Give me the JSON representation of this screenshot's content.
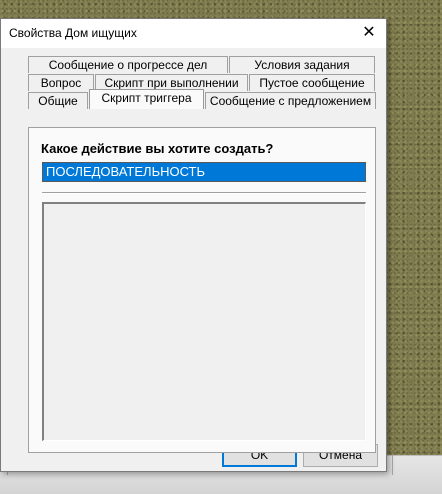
{
  "window": {
    "title": "Свойства Дом ищущих",
    "close_glyph": "✕"
  },
  "tabs": {
    "row1": [
      "Сообщение о прогрессе дел",
      "Условия задания"
    ],
    "row2": [
      "Вопрос",
      "Скрипт при выполнении",
      "Пустое сообщение"
    ],
    "row3": [
      "Общие",
      "Скрипт триггера",
      "Сообщение с предложением"
    ],
    "active": "Скрипт триггера"
  },
  "panel": {
    "question": "Какое действие вы хотите создать?",
    "selected_action": "ПОСЛЕДОВАТЕЛЬНОСТЬ"
  },
  "buttons": {
    "ok": "OK",
    "cancel": "Отмена"
  },
  "colors": {
    "selection": "#0078d7",
    "dialog_bg": "#f0f0f0",
    "desktop": "#7d7a4e"
  }
}
